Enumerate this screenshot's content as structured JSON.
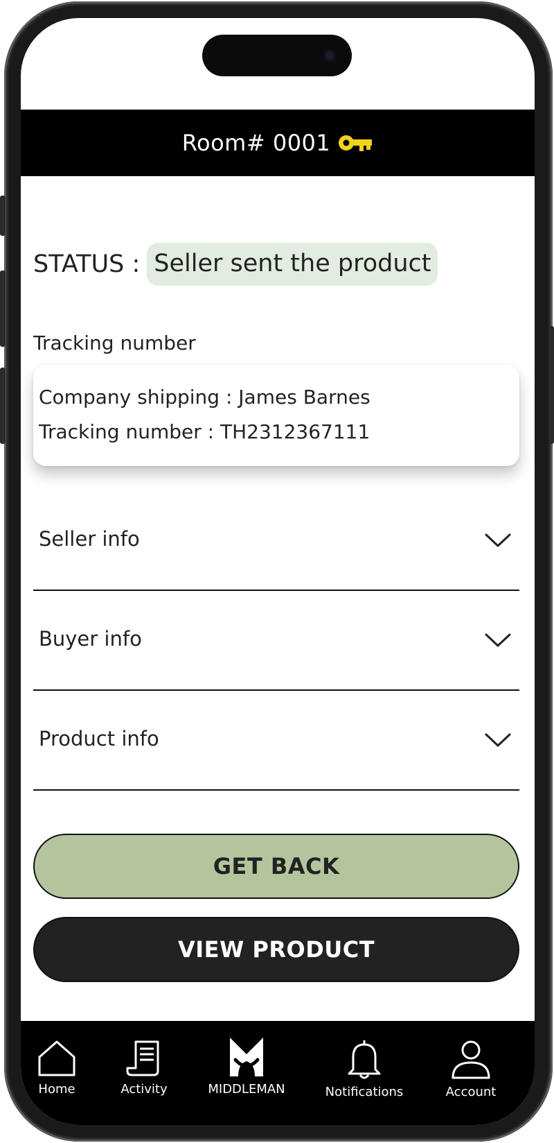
{
  "header": {
    "title": "Room# 0001",
    "key_icon": "key-icon",
    "key_color": "#f2d21b"
  },
  "status": {
    "label": "STATUS :",
    "value": "Seller sent the product",
    "badge_color": "#e2ece0"
  },
  "tracking": {
    "heading": "Tracking number",
    "company_line": "Company shipping :  James Barnes",
    "number_line": "Tracking number :  TH2312367111"
  },
  "sections": [
    {
      "label": "Seller info",
      "icon": "chevron-down-icon"
    },
    {
      "label": "Buyer info",
      "icon": "chevron-down-icon"
    },
    {
      "label": "Product info",
      "icon": "chevron-down-icon"
    }
  ],
  "buttons": {
    "get_back": "GET BACK",
    "view_product": "VIEW PRODUCT",
    "get_back_color": "#b4c59e",
    "view_product_color": "#222222"
  },
  "tabbar": {
    "items": [
      {
        "label": "Home",
        "icon": "home-icon"
      },
      {
        "label": "Activity",
        "icon": "receipt-icon"
      },
      {
        "label": "MIDDLEMAN",
        "icon": "middleman-logo-icon"
      },
      {
        "label": "Notifications",
        "icon": "bell-icon"
      },
      {
        "label": "Account",
        "icon": "user-icon"
      }
    ]
  }
}
